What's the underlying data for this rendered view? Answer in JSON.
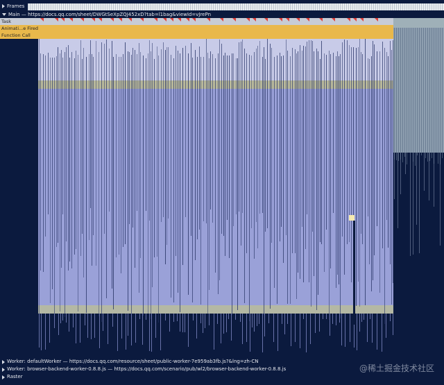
{
  "tracks": {
    "frames_label": "Frames",
    "main_label": "Main — https://docs.qq.com/sheet/DWGtSeXpZQJ452xD?tab=l1bag&viewId=vJrePn",
    "lanes": [
      "Task",
      "Animati...e Fired",
      "Function Call"
    ]
  },
  "workers": [
    "Worker: defaultWorker — https://docs.qq.com/resource/sheet/public-worker-7e959ab3fb.js?&lng=zh-CN",
    "Worker: browser-backend-worker-0.8.8.js — https://docs.qq.com/scenario/pub/wl2/browser-backend-worker-0.8.8.js",
    "Raster"
  ],
  "watermark": "@稀土掘金技术社区",
  "colors": {
    "background": "#0b1a3e",
    "task": "#c7ccd6",
    "function_call": "#e9b84b",
    "script_purple": "#9aa1d8",
    "script_light": "#c8cbe8",
    "marker_red": "#e0403a"
  }
}
